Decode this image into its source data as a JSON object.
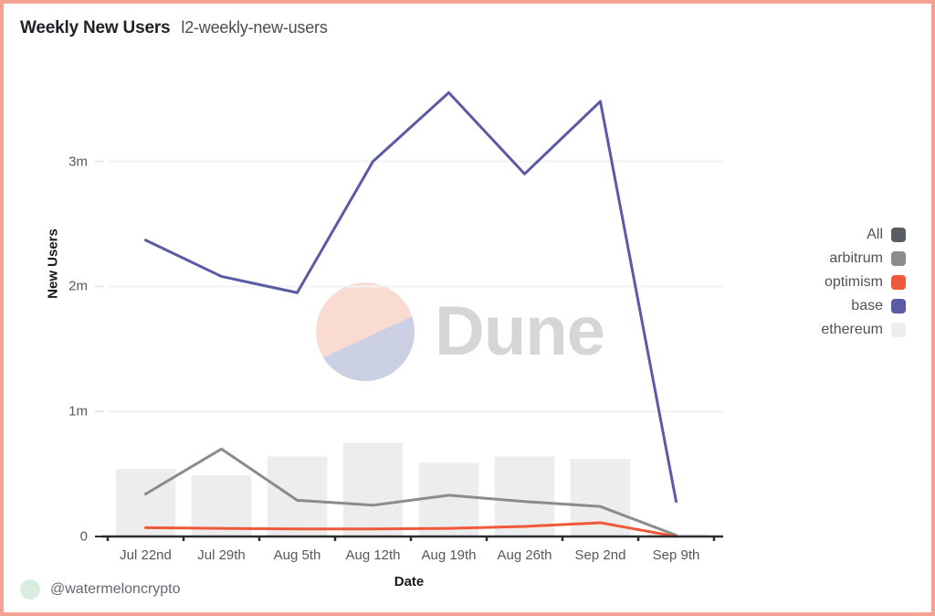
{
  "header": {
    "title": "Weekly New Users",
    "subtitle": "l2-weekly-new-users"
  },
  "footer": {
    "handle": "@watermeloncrypto",
    "avatar_color": "#d9ece0",
    "avatar_icon": "user-avatar-icon"
  },
  "watermark": {
    "text": "Dune",
    "text_color": "#d6d6d6",
    "mark_top_color": "#fadbd2",
    "mark_bottom_color": "#ccd0e4",
    "mark_icon": "dune-logo-icon"
  },
  "frame": {
    "border_color": "#f4a392",
    "background": "#ffffff"
  },
  "legend": {
    "position": "right",
    "items": [
      {
        "label": "All",
        "color": "#5a5d64",
        "type": "line"
      },
      {
        "label": "arbitrum",
        "color": "#8b8b8d",
        "type": "line"
      },
      {
        "label": "optimism",
        "color": "#f0583a",
        "type": "line"
      },
      {
        "label": "base",
        "color": "#5a5aa5",
        "type": "line"
      },
      {
        "label": "ethereum",
        "color": "#ededed",
        "type": "bar"
      }
    ]
  },
  "chart_data": {
    "type": "line",
    "title": "Weekly New Users",
    "subtitle": "l2-weekly-new-users",
    "xlabel": "Date",
    "ylabel": "New Users",
    "categories": [
      "Jul 22nd",
      "Jul 29th",
      "Aug 5th",
      "Aug 12th",
      "Aug 19th",
      "Aug 26th",
      "Sep 2nd",
      "Sep 9th"
    ],
    "ylim": [
      0,
      3.75
    ],
    "y_ticks": [
      0,
      1,
      2,
      3
    ],
    "y_tick_labels": [
      "0",
      "1m",
      "2m",
      "3m"
    ],
    "y_unit": "millions",
    "grid": true,
    "grid_axis": "y",
    "series": [
      {
        "name": "ethereum",
        "type": "bar",
        "color": "#ededed",
        "values": [
          0.54,
          0.49,
          0.64,
          0.75,
          0.59,
          0.64,
          0.62,
          0.02
        ]
      },
      {
        "name": "arbitrum",
        "type": "line",
        "color": "#8b8b8d",
        "values": [
          0.34,
          0.7,
          0.29,
          0.25,
          0.33,
          0.28,
          0.24,
          0.01
        ]
      },
      {
        "name": "optimism",
        "type": "line",
        "color": "#f0583a",
        "values": [
          0.07,
          0.065,
          0.06,
          0.06,
          0.065,
          0.08,
          0.11,
          0.0
        ]
      },
      {
        "name": "base",
        "type": "line",
        "color": "#5a5aa5",
        "values": [
          2.37,
          2.08,
          1.95,
          3.0,
          3.55,
          2.9,
          3.48,
          0.28
        ]
      }
    ]
  }
}
